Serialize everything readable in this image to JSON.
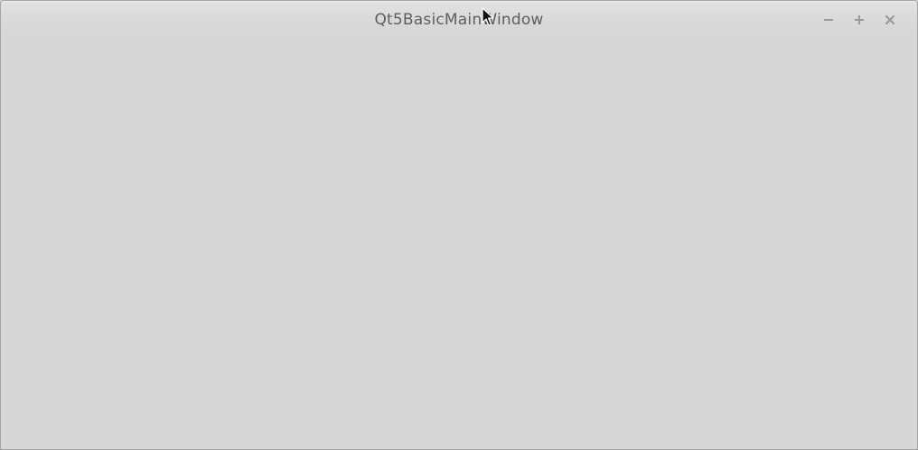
{
  "window": {
    "title": "Qt5BasicMainWindow",
    "controls": [
      "minimize-icon",
      "maximize-icon",
      "close-icon"
    ]
  },
  "colors": {
    "background": "#d6d6d6",
    "title_text": "#5e5e5e",
    "control_icon": "#9a9a9a"
  }
}
